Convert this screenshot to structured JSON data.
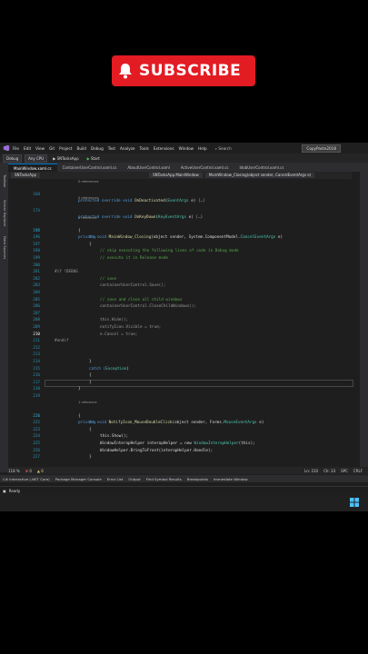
{
  "overlay": {
    "subscribe_label": "SUBSCRIBE"
  },
  "menu": {
    "items": [
      "File",
      "Edit",
      "View",
      "Git",
      "Project",
      "Build",
      "Debug",
      "Test",
      "Analyze",
      "Tools",
      "Extensions",
      "Window",
      "Help"
    ],
    "search_label": "Search",
    "solution_name": "CopyPaste2018"
  },
  "toolbar": {
    "config": "Debug",
    "platform": "Any CPU",
    "project": "SNTasksApp",
    "start_label": "Start"
  },
  "tabs": [
    "MainWindow.xaml.cs",
    "ContainerUserControl.xaml.cs",
    "AboutUserControl.xaml",
    "ActiveUserControl.xaml.cs",
    "IdobUserControl.xaml.cs"
  ],
  "tabs_row2": [
    "EngagementUser...ableHelper.cs",
    "IdobUserControl.xaml.cs",
    "StockClient.cs"
  ],
  "sidebar_left": [
    "Toolbox",
    "Server Explorer",
    "Data Sources"
  ],
  "navbar": {
    "project": "SNTasksApp",
    "class": "SNTasksApp.MainWindow",
    "member": "MainWindow_Closing(object sender, CancelEventArgs e)"
  },
  "codelens": {
    "refs0": "0 references",
    "refs1": "1 reference"
  },
  "lines": {
    "l168": "168",
    "l174": "174",
    "l194": "194",
    "l195": "195",
    "l196": "196",
    "l197": "197",
    "l198": "198",
    "l199": "199",
    "l200": "200",
    "l201": "201",
    "l202": "202",
    "l203": "203",
    "l204": "204",
    "l205": "205",
    "l206": "206",
    "l207": "207",
    "l208": "208",
    "l209": "209",
    "l210": "210",
    "l211": "211",
    "l212": "212",
    "l213": "213",
    "l214": "214",
    "l215": "215",
    "l216": "216",
    "l217": "217",
    "l218": "218",
    "l219": "219",
    "l220": "220",
    "l221": "221",
    "l222": "222",
    "l223": "223",
    "l224": "224",
    "l225": "225",
    "l226": "226",
    "l227": "227",
    "l228": "228"
  },
  "code": {
    "c168_a": "protected override void ",
    "c168_b": "OnDeactivated",
    "c168_c": "(",
    "c168_d": "EventArgs",
    "c168_e": " e)",
    "c174_a": "protected override void ",
    "c174_b": "OnKeyDown",
    "c174_c": "(",
    "c174_d": "KeyEventArgs",
    "c174_e": " e)",
    "c194_a": "private void ",
    "c194_b": "MainWindow_Closing",
    "c194_c": "(object sender, System.ComponentModel.",
    "c194_d": "CancelEventArgs",
    "c194_e": " e)",
    "c195": "{",
    "c196": "try",
    "c197": "{",
    "c198": "// skip executing the following lines of code in Debug mode",
    "c199": "// execute it in Release mode",
    "c201": "#if !DEBUG",
    "c202": "// save",
    "c203": "containerUserControl.Save();",
    "c205": "// save and close all child windows",
    "c206": "containerUserControl.CloseChildWindows();",
    "c208": "this.Hide();",
    "c209": "notifyIcon.Visible = true;",
    "c210": "e.Cancel = true;",
    "c211": "#endif",
    "c214": "}",
    "c215_a": "catch (",
    "c215_b": "Exception",
    "c215_c": ")",
    "c216": "{",
    "c217": "}",
    "c218": "}",
    "c220_a": "private void ",
    "c220_b": "NotifyIcon_MouseDoubleClick",
    "c220_c": "(object sender, Forms.",
    "c220_d": "MouseEventArgs",
    "c220_e": " e)",
    "c221": "{",
    "c222": "try",
    "c223": "{",
    "c224": "this.Show();",
    "c225_a": "WindowInteropHelper interopHelper = new ",
    "c225_b": "WindowInteropHelper",
    "c225_c": "(this);",
    "c226": "WindowHelper.BringToFront(interopHelper.Handle);",
    "c227": "}"
  },
  "status": {
    "zoom": "118 %",
    "errors": "0",
    "warnings": "6",
    "position": "Ln: 210",
    "column": "Ch: 33",
    "spc": "SPC",
    "crlf": "CRLF"
  },
  "bottom_tabs": [
    "C# Interactive (.NET Core)",
    "Package Manager Console",
    "Error List",
    "Output",
    "Find Symbol Results",
    "Breakpoints",
    "Immediate Window"
  ],
  "statusbar": {
    "ready": "Ready"
  }
}
